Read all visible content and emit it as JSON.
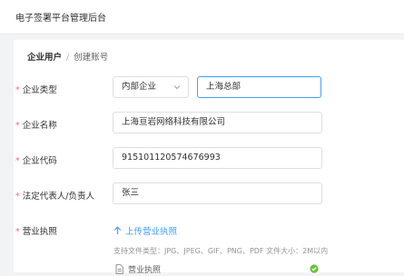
{
  "header": {
    "title": "电子签署平台管理后台"
  },
  "breadcrumb": {
    "parent": "企业用户",
    "separator": "/",
    "current": "创建账号"
  },
  "form": {
    "company_type": {
      "label": "企业类型",
      "selected": "内部企业",
      "branch_value": "上海总部"
    },
    "company_name": {
      "label": "企业名称",
      "value": "上海亘岩网络科技有限公司"
    },
    "company_code": {
      "label": "企业代码",
      "value": "915101120574676993"
    },
    "legal_rep": {
      "label": "法定代表人/负责人",
      "value": "张三"
    },
    "license": {
      "label": "营业执照",
      "upload_label": "上传营业执照",
      "hint": "支持文件类型：JPG、JPEG、GIF、PNG、PDF 文件大小：2M以内",
      "file_name": "营业执照",
      "upload_status": "success"
    },
    "required_mark": "*"
  },
  "colors": {
    "accent": "#409eff",
    "required": "#f56c6c",
    "success": "#67c23a",
    "border": "#dcdfe6"
  },
  "icons": {
    "select": "chevron-down-icon",
    "upload": "upload-arrow-icon",
    "file": "document-icon",
    "status": "success-check-icon"
  }
}
